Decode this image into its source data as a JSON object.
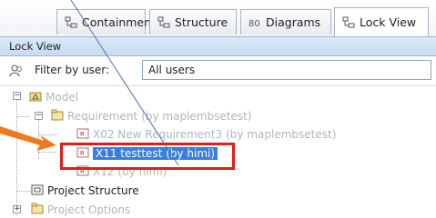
{
  "tabs": [
    {
      "label": "Containment",
      "icon": "containment-icon",
      "active": false
    },
    {
      "label": "Structure",
      "icon": "structure-icon",
      "active": false
    },
    {
      "label": "Diagrams",
      "icon": "diagrams-icon",
      "active": false
    },
    {
      "label": "Lock View",
      "icon": "lock-view-icon",
      "active": true
    }
  ],
  "panel": {
    "title": "Lock View"
  },
  "filter": {
    "label": "Filter by user:",
    "value": "All users",
    "icon": "users-icon"
  },
  "tree": {
    "model": "Model",
    "requirement": "Requirement",
    "requirement_owner": "(by maplembsetest)",
    "x02_label": "X02 New Requirement3",
    "x02_owner": "(by maplembsetest)",
    "x11_label": "X11 testtest (by himi)",
    "x12_label": "X12",
    "x12_owner": "(by himi)",
    "project_structure": "Project Structure",
    "project_options": "Project Options"
  },
  "colors": {
    "highlight": "#e21b1b",
    "selection": "#3b7ddd",
    "arrow": "#f07a1a",
    "pointer_line": "#4a6fb5"
  }
}
